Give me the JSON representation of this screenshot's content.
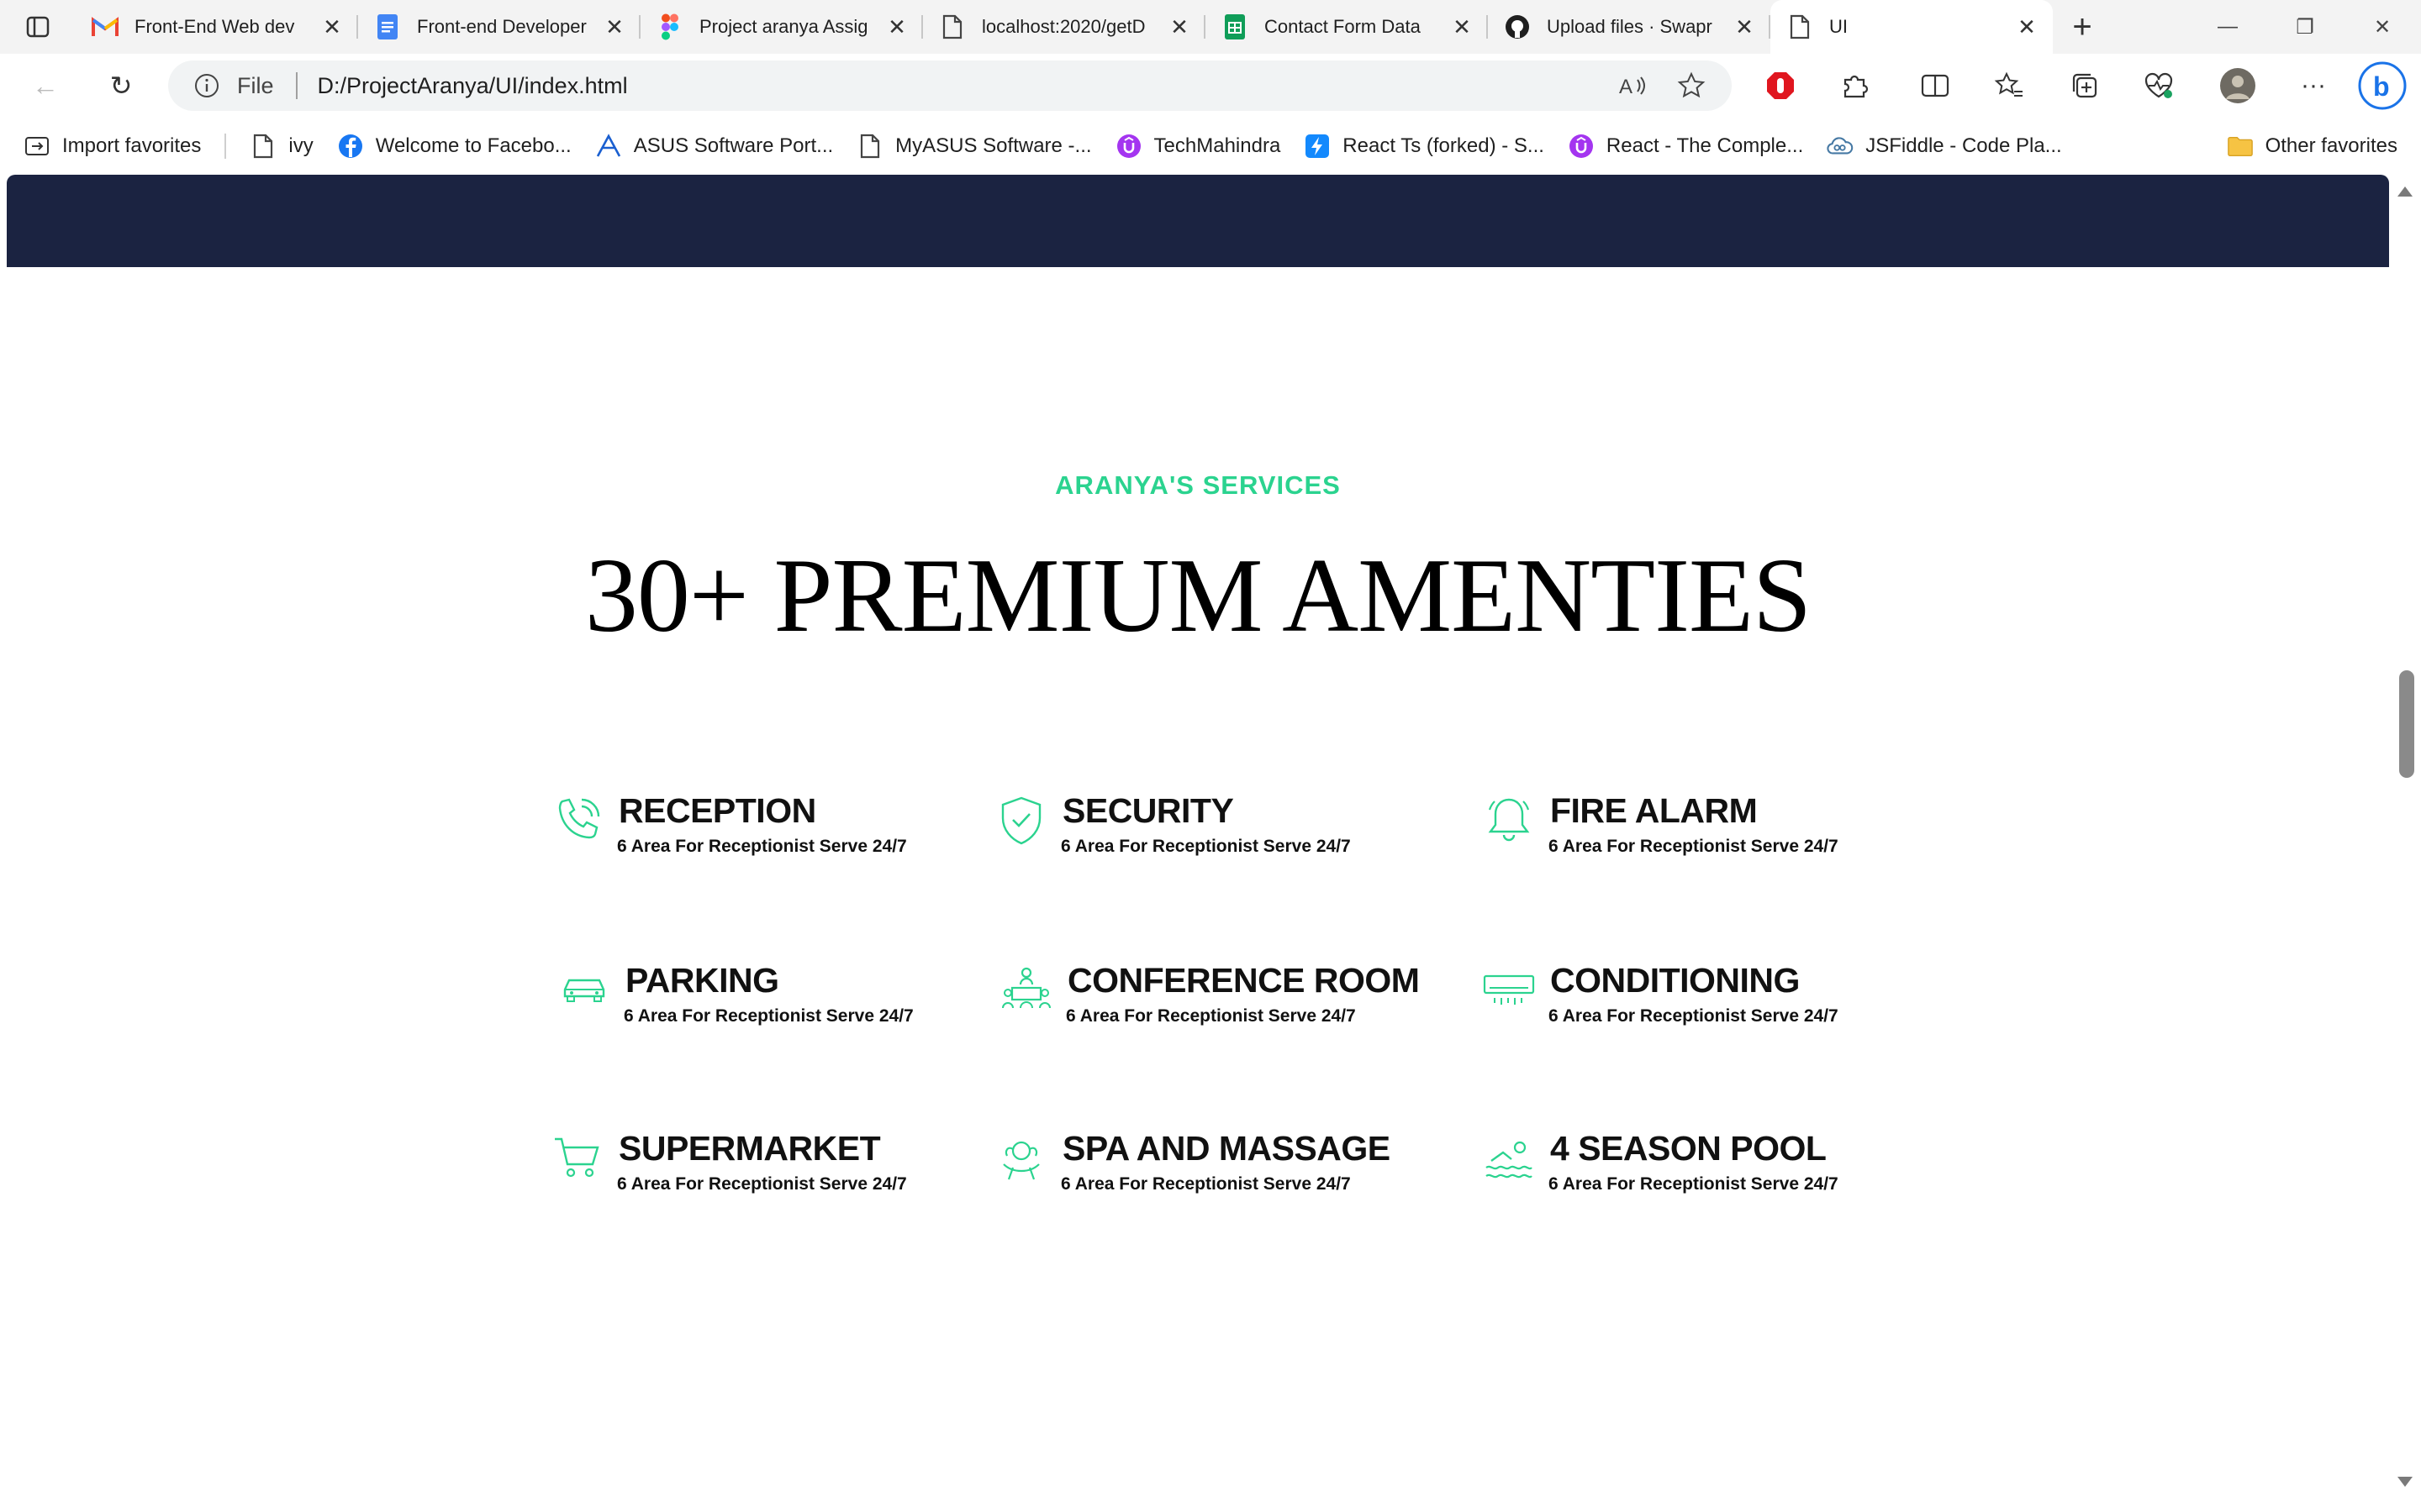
{
  "browser": {
    "tabs": [
      {
        "title": "Front-End Web dev",
        "icon": "gmail-icon"
      },
      {
        "title": "Front-end Developer",
        "icon": "docs-icon"
      },
      {
        "title": "Project aranya Assig",
        "icon": "figma-icon"
      },
      {
        "title": "localhost:2020/getD",
        "icon": "page-icon"
      },
      {
        "title": "Contact Form Data",
        "icon": "sheets-icon"
      },
      {
        "title": "Upload files · Swapr",
        "icon": "github-icon"
      },
      {
        "title": "UI",
        "icon": "page-icon"
      }
    ],
    "address": {
      "scheme": "File",
      "url": "D:/ProjectAranya/UI/index.html"
    },
    "bookmarks": [
      {
        "label": "Import favorites",
        "icon": "import-icon"
      },
      {
        "label": "ivy",
        "icon": "page-icon"
      },
      {
        "label": "Welcome to Facebo...",
        "icon": "facebook-icon"
      },
      {
        "label": "ASUS Software Port...",
        "icon": "asus-icon"
      },
      {
        "label": "MyASUS Software -...",
        "icon": "page-icon"
      },
      {
        "label": "TechMahindra",
        "icon": "udemy-icon"
      },
      {
        "label": "React Ts (forked) - S...",
        "icon": "stackblitz-icon"
      },
      {
        "label": "React - The Comple...",
        "icon": "udemy-icon"
      },
      {
        "label": "JSFiddle - Code Pla...",
        "icon": "jsfiddle-icon"
      }
    ],
    "other_favorites": "Other favorites",
    "colors": {
      "accent": "#2bd38f",
      "nav_band": "#1b2341"
    }
  },
  "page": {
    "eyebrow": "ARANYA'S SERVICES",
    "headline": "30+ PREMIUM AMENTIES",
    "services": [
      {
        "name": "RECEPTION",
        "desc": "6 Area For Receptionist Serve 24/7",
        "icon": "phone-icon"
      },
      {
        "name": "SECURITY",
        "desc": "6 Area For Receptionist Serve 24/7",
        "icon": "shield-check-icon"
      },
      {
        "name": "FIRE ALARM",
        "desc": "6 Area For Receptionist Serve 24/7",
        "icon": "bell-icon"
      },
      {
        "name": "PARKING",
        "desc": "6 Area For Receptionist Serve 24/7",
        "icon": "car-icon"
      },
      {
        "name": "CONFERENCE ROOM",
        "desc": "6 Area For Receptionist Serve 24/7",
        "icon": "meeting-icon"
      },
      {
        "name": "CONDITIONING",
        "desc": "6 Area For Receptionist Serve 24/7",
        "icon": "air-conditioner-icon"
      },
      {
        "name": "SUPERMARKET",
        "desc": "6 Area For Receptionist Serve 24/7",
        "icon": "cart-icon"
      },
      {
        "name": "SPA AND MASSAGE",
        "desc": "6 Area For Receptionist Serve 24/7",
        "icon": "spa-icon"
      },
      {
        "name": "4 SEASON POOL",
        "desc": "6 Area For Receptionist Serve 24/7",
        "icon": "swimmer-icon"
      }
    ]
  }
}
